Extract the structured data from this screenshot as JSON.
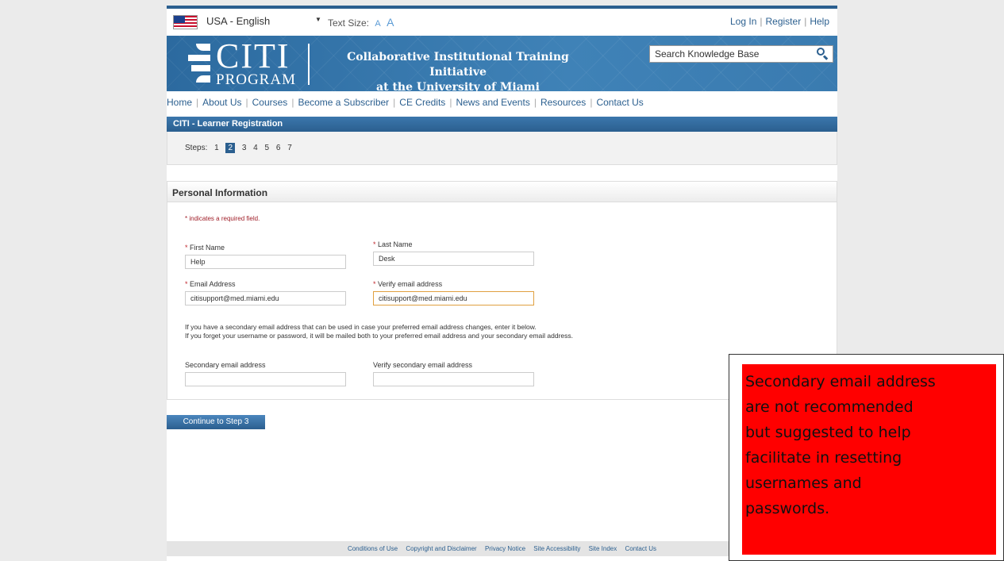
{
  "topbar": {
    "language": "USA - English",
    "text_size_label": "Text Size:",
    "text_size_small": "A",
    "text_size_large": "A",
    "links": [
      "Log In",
      "Register",
      "Help"
    ]
  },
  "banner": {
    "logo_text": "CITI",
    "logo_sub": "PROGRAM",
    "tagline_line1": "Collaborative Institutional Training Initiative",
    "tagline_line2": "at the University of Miami",
    "search_placeholder": "Search Knowledge Base"
  },
  "nav": [
    "Home",
    "About Us",
    "Courses",
    "Become a Subscriber",
    "CE Credits",
    "News and Events",
    "Resources",
    "Contact Us"
  ],
  "registration": {
    "title": "CITI - Learner Registration",
    "steps_label": "Steps:",
    "steps": [
      "1",
      "2",
      "3",
      "4",
      "5",
      "6",
      "7"
    ],
    "active_step": "2"
  },
  "personal_info": {
    "title": "Personal Information",
    "required_note": "indicates a required field.",
    "required_marker": "*",
    "first_name_label": "First Name",
    "first_name_value": "Help",
    "last_name_label": "Last Name",
    "last_name_value": "Desk",
    "email_label": "Email Address",
    "email_value": "citisupport@med.miami.edu",
    "verify_email_label": "Verify email address",
    "verify_email_value": "citisupport@med.miami.edu",
    "help_line1": "If you have a secondary email address that can be used in case your preferred email address changes, enter it below.",
    "help_line2": "If you forget your username or password, it will be mailed both to your preferred email address and your secondary email address.",
    "secondary_email_label": "Secondary email address",
    "secondary_email_value": "",
    "verify_secondary_label": "Verify secondary email address",
    "verify_secondary_value": ""
  },
  "continue_button": "Continue to Step 3",
  "footer": [
    "Conditions of Use",
    "Copyright and Disclaimer",
    "Privacy Notice",
    "Site Accessibility",
    "Site Index",
    "Contact Us"
  ],
  "callout": {
    "line1": "Secondary email address",
    "line2": "are not recommended",
    "line3": "but suggested to help",
    "line4": "facilitate in resetting",
    "line5": "usernames and",
    "line6": "passwords.",
    "background": "#ff0000"
  },
  "colors": {
    "brand_blue": "#2b5f8f",
    "required_red": "#c0282e"
  }
}
